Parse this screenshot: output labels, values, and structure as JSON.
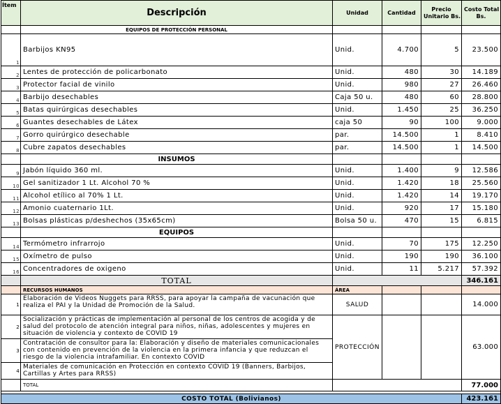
{
  "header": {
    "item": "Ítem",
    "descripcion": "Descripción",
    "unidad": "Unidad",
    "cantidad": "Cantidad",
    "precio_line1": "Precio",
    "precio_line2": "Unitario   Bs.",
    "costo_line1": "Costo Total",
    "costo_line2": "Bs."
  },
  "sections": {
    "epp": "EQUIPOS DE PROTECCIÓN PERSONAL",
    "insumos": "INSUMOS",
    "equipos": "EQUIPOS"
  },
  "epp_rows": [
    {
      "n": "1",
      "desc": "Barbijos KN95",
      "unit": "Unid.",
      "qty": "4.700",
      "price": "5",
      "total": "23.500"
    },
    {
      "n": "2",
      "desc": "Lentes de protección de policarbonato",
      "unit": "Unid.",
      "qty": "480",
      "price": "30",
      "total": "14.189"
    },
    {
      "n": "3",
      "desc": "Protector facial de vinilo",
      "unit": "Unid.",
      "qty": "980",
      "price": "27",
      "total": "26.460"
    },
    {
      "n": "4",
      "desc": "Barbijo desechables",
      "unit": "Caja 50 u.",
      "qty": "480",
      "price": "60",
      "total": "28.800"
    },
    {
      "n": "5",
      "desc": "Batas quirúrgicas desechables",
      "unit": "Unid.",
      "qty": "1.450",
      "price": "25",
      "total": "36.250"
    },
    {
      "n": "6",
      "desc": "Guantes desechables de Látex",
      "unit": "caja 50",
      "qty": "90",
      "price": "100",
      "total": "9.000"
    },
    {
      "n": "7",
      "desc": "Gorro quirúrgico desechable",
      "unit": "par.",
      "qty": "14.500",
      "price": "1",
      "total": "8.410"
    },
    {
      "n": "8",
      "desc": "Cubre zapatos desechables",
      "unit": "par.",
      "qty": "14.500",
      "price": "1",
      "total": "14.500"
    }
  ],
  "insumos_rows": [
    {
      "n": "9",
      "desc": "Jabón líquido 360 ml.",
      "unit": "Unid.",
      "qty": "1.400",
      "price": "9",
      "total": "12.586"
    },
    {
      "n": "10",
      "desc": "Gel sanitizador 1 Lt. Alcohol 70 %",
      "unit": "Unid.",
      "qty": "1.420",
      "price": "18",
      "total": "25.560"
    },
    {
      "n": "11",
      "desc": "Alcohol etílico al 70%   1 Lt.",
      "unit": "Unid.",
      "qty": "1.420",
      "price": "14",
      "total": "19.170"
    },
    {
      "n": "12",
      "desc": "Amonio cuaternario 1Lt.",
      "unit": "Unid.",
      "qty": "920",
      "price": "17",
      "total": "15.180"
    },
    {
      "n": "13",
      "desc": "Bolsas plásticas p/deshechos (35x65cm)",
      "unit": "Bolsa 50 u.",
      "qty": "470",
      "price": "15",
      "total": "6.815"
    }
  ],
  "equipos_rows": [
    {
      "n": "14",
      "desc": "Termómetro infrarrojo",
      "unit": "Unid.",
      "qty": "70",
      "price": "175",
      "total": "12.250"
    },
    {
      "n": "15",
      "desc": "Oxímetro de pulso",
      "unit": "Unid.",
      "qty": "190",
      "price": "190",
      "total": "36.100"
    },
    {
      "n": "16",
      "desc": "Concentradores de oxigeno",
      "unit": "Unid.",
      "qty": "11",
      "price": "5.217",
      "total": "57.392"
    }
  ],
  "total1": {
    "label": "TOTAL",
    "value": "346.161"
  },
  "rrhh": {
    "header_desc": "RECURSOS HUMANOS",
    "header_area": "ÁREA",
    "rows": [
      {
        "n": "1",
        "desc": "Elaboración de Videos Nuggets para RRSS, para apoyar la campaña de vacunación que realiza el PAI y la Unidad de Promoción de la Salud."
      },
      {
        "n": "2",
        "desc": "Socialización y prácticas de implementación al personal de los centros de acogida y de salud del protocolo de atención integral para niños, niñas, adolescentes y mujeres en situación de violencia y contexto de COVID 19"
      },
      {
        "n": "3",
        "desc": "Contratación de consultor para la: Elaboración y diseño de materiales comunicacionales con contenido en prevención de la violencia en la primera infancia y que reduzcan el riesgo de la violencia intrafamiliar. En contexto COVID"
      },
      {
        "n": "4",
        "desc": "Materiales de comunicación en Protección en contexto COVID 19 (Banners, Barbijos, Cartillas y Artes para RRSS)"
      }
    ],
    "area_salud": "SALUD",
    "amount_salud": "14.000",
    "area_proteccion": "PROTECCIÓN",
    "amount_proteccion": "63.000"
  },
  "total2": {
    "label": "TOTAL",
    "value": "77.000"
  },
  "grand": {
    "label": "COSTO TOTAL (Bolivianos)",
    "value": "423.161"
  }
}
